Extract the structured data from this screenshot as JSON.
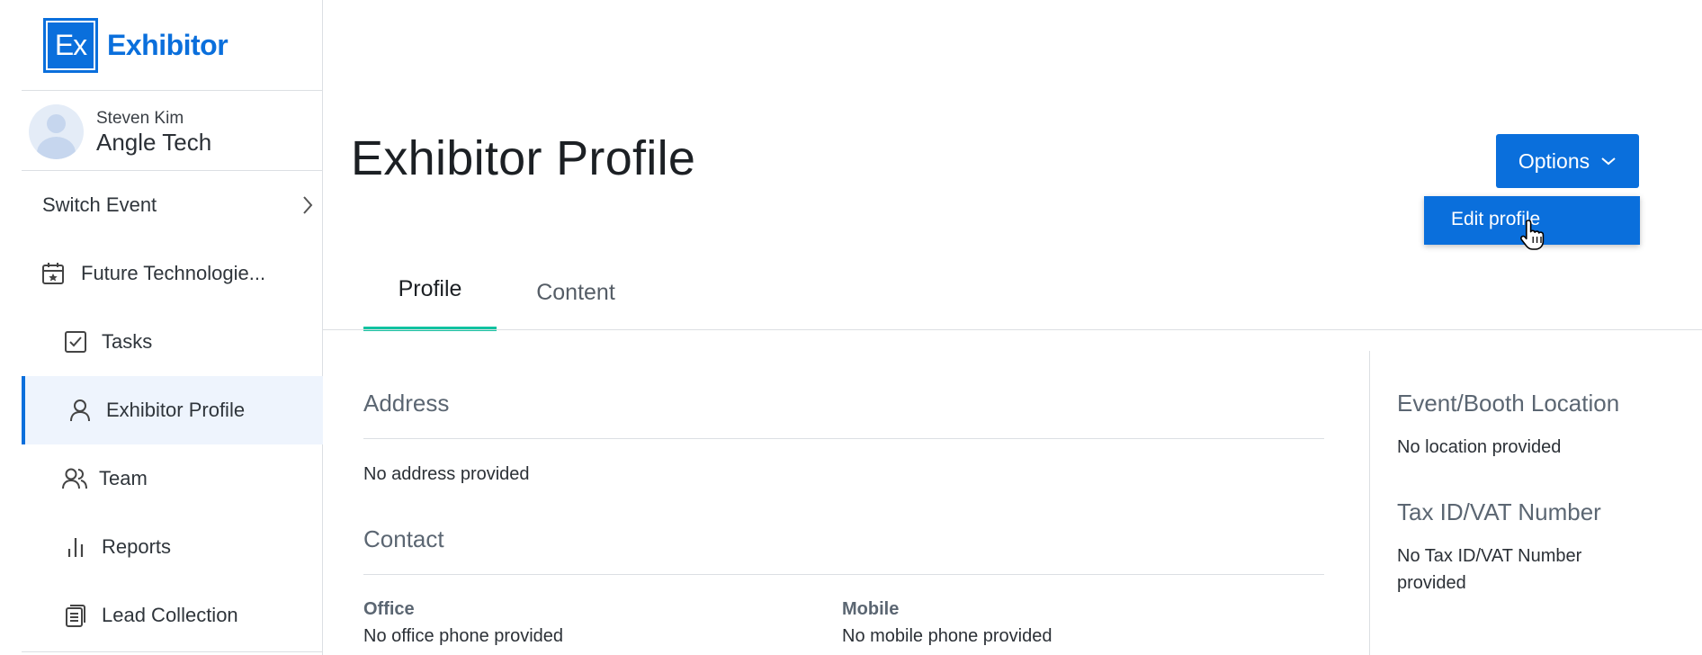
{
  "brand": {
    "logo_mark": "Ex",
    "name": "Exhibitor",
    "color": "#0a6fdc"
  },
  "user": {
    "name": "Steven Kim",
    "company": "Angle Tech"
  },
  "sidebar": {
    "switch_event": "Switch Event",
    "event_name": "Future Technologie...",
    "items": [
      {
        "label": "Tasks",
        "icon": "checkbox-icon"
      },
      {
        "label": "Exhibitor Profile",
        "icon": "person-icon",
        "active": true
      },
      {
        "label": "Team",
        "icon": "team-icon"
      },
      {
        "label": "Reports",
        "icon": "bar-chart-icon"
      },
      {
        "label": "Lead Collection",
        "icon": "document-stack-icon"
      }
    ]
  },
  "header": {
    "title": "Exhibitor Profile",
    "options_label": "Options",
    "menu_items": [
      "Edit profile"
    ]
  },
  "tabs": [
    {
      "label": "Profile",
      "active": true
    },
    {
      "label": "Content",
      "active": false
    }
  ],
  "address": {
    "title": "Address",
    "value": "No address provided"
  },
  "contact": {
    "title": "Contact",
    "office_label": "Office",
    "office_value": "No office phone provided",
    "mobile_label": "Mobile",
    "mobile_value": "No mobile phone provided"
  },
  "side_panel": {
    "location_title": "Event/Booth Location",
    "location_value": "No location provided",
    "tax_title": "Tax ID/VAT Number",
    "tax_value_line1": "No Tax ID/VAT Number",
    "tax_value_line2": "provided"
  },
  "colors": {
    "accent": "#0a6fdc",
    "tab_indicator": "#11c2a0"
  }
}
